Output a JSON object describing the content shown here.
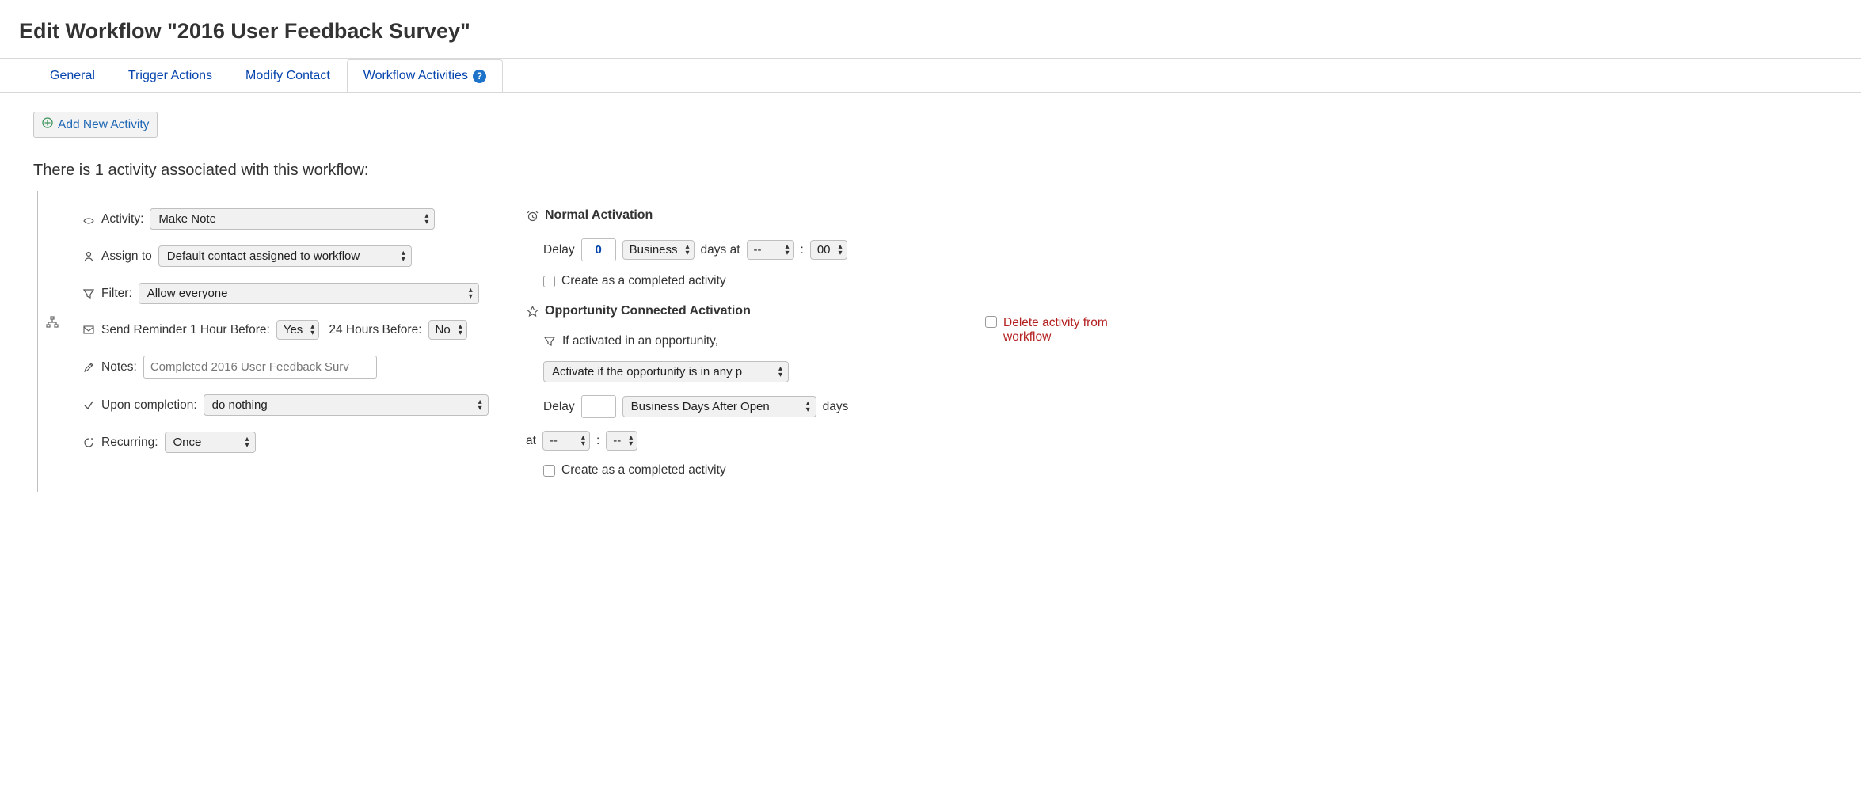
{
  "title": "Edit Workflow \"2016 User Feedback Survey\"",
  "tabs": {
    "general": "General",
    "trigger": "Trigger Actions",
    "modify": "Modify Contact",
    "activities": "Workflow Activities"
  },
  "addButton": "Add New Activity",
  "summary": "There is 1 activity associated with this workflow:",
  "activity": {
    "labels": {
      "activity": "Activity:",
      "assign": "Assign to",
      "filter": "Filter:",
      "reminder1": "Send Reminder 1 Hour Before:",
      "reminder24": "24 Hours Before:",
      "notes": "Notes:",
      "upon": "Upon completion:",
      "recurring": "Recurring:"
    },
    "values": {
      "activity": "Make Note",
      "assign": "Default contact assigned to workflow",
      "filter": "Allow everyone",
      "reminder1": "Yes",
      "reminder24": "No",
      "notes": "Completed 2016 User Feedback Surv",
      "upon": "do nothing",
      "recurring": "Once"
    }
  },
  "normal": {
    "title": "Normal Activation",
    "delayLabel": "Delay",
    "delayValue": "0",
    "dayType": "Business",
    "daysAt": "days at",
    "hour": "--",
    "colon": ":",
    "minute": "00",
    "completed": "Create as a completed activity"
  },
  "opp": {
    "title": "Opportunity Connected Activation",
    "ifActivated": "If activated in an opportunity,",
    "pipeline": "Activate if the opportunity is in any p",
    "delayLabel": "Delay",
    "delayValue": "",
    "daysAfter": "Business Days After Open",
    "daysWord": "days",
    "atWord": "at",
    "hour": "--",
    "colon": ":",
    "minute": "--",
    "completed": "Create as a completed activity"
  },
  "delete": "Delete activity from workflow"
}
